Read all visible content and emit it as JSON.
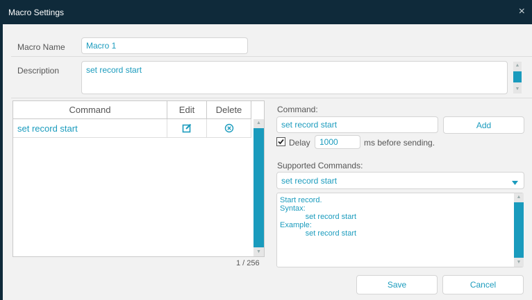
{
  "window": {
    "title": "Macro Settings",
    "close_glyph": "×"
  },
  "form": {
    "macro_name_label": "Macro Name",
    "macro_name_value": "Macro 1",
    "description_label": "Description",
    "description_value": "set record start"
  },
  "table": {
    "headers": {
      "command": "Command",
      "edit": "Edit",
      "delete": "Delete"
    },
    "rows": [
      {
        "command": "set record start"
      }
    ],
    "count": "1 / 256"
  },
  "command_panel": {
    "command_label": "Command:",
    "command_value": "set record start",
    "add_label": "Add",
    "delay_label": "Delay",
    "delay_value": "1000",
    "delay_checked": true,
    "delay_suffix": "ms before sending.",
    "supported_label": "Supported Commands:",
    "supported_selected": "set record start",
    "help_text": "Start record.\nSyntax:\n            set record start\nExample:\n            set record start"
  },
  "footer": {
    "save_label": "Save",
    "cancel_label": "Cancel"
  },
  "colors": {
    "accent": "#1a9bbd",
    "titlebar": "#0f2a3a",
    "background": "#f2f2f2"
  }
}
